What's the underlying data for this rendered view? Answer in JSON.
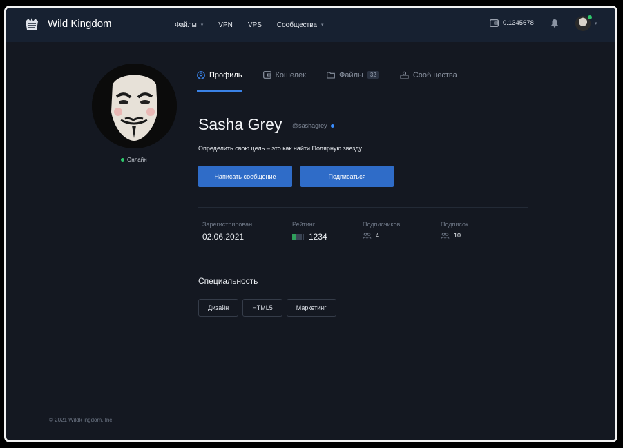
{
  "header": {
    "brand": "Wild Kingdom",
    "nav": [
      {
        "label": "Файлы",
        "has_dropdown": true
      },
      {
        "label": "VPN",
        "has_dropdown": false
      },
      {
        "label": "VPS",
        "has_dropdown": false
      },
      {
        "label": "Сообщества",
        "has_dropdown": true
      }
    ],
    "wallet_balance": "0.1345678",
    "icons": {
      "logo": "crown-logo-icon",
      "wallet": "wallet-icon",
      "notifications": "bell-icon",
      "dropdown": "chevron-down-icon"
    }
  },
  "profile": {
    "status": "Онлайн",
    "tabs": [
      {
        "label": "Профиль",
        "icon": "user-circle-icon",
        "active": true
      },
      {
        "label": "Кошелек",
        "icon": "wallet-icon",
        "active": false
      },
      {
        "label": "Файлы",
        "icon": "folder-icon",
        "active": false,
        "badge": "32"
      },
      {
        "label": "Сообщества",
        "icon": "community-icon",
        "active": false
      }
    ],
    "name": "Sasha Grey",
    "handle": "@sashagrey",
    "bio": "Определить свою цель – это как найти Полярную звезду. ...",
    "buttons": {
      "message": "Написать сообщение",
      "subscribe": "Подписаться"
    },
    "stats": {
      "registered": {
        "label": "Зарегистрирован",
        "value": "02.06.2021"
      },
      "rating": {
        "label": "Рейтинг",
        "value": "1234"
      },
      "followers": {
        "label": "Подписчиков",
        "value": "4"
      },
      "following": {
        "label": "Подписок",
        "value": "10"
      }
    },
    "specialty": {
      "title": "Специальность",
      "tags": [
        "Дизайн",
        "HTML5",
        "Маркетинг"
      ]
    }
  },
  "footer": {
    "copyright": "© 2021 Wildk ingdom, Inc."
  },
  "colors": {
    "accent": "#2f6cc8",
    "online": "#2ec76b",
    "header_bg": "#172131",
    "page_bg": "#141821"
  }
}
